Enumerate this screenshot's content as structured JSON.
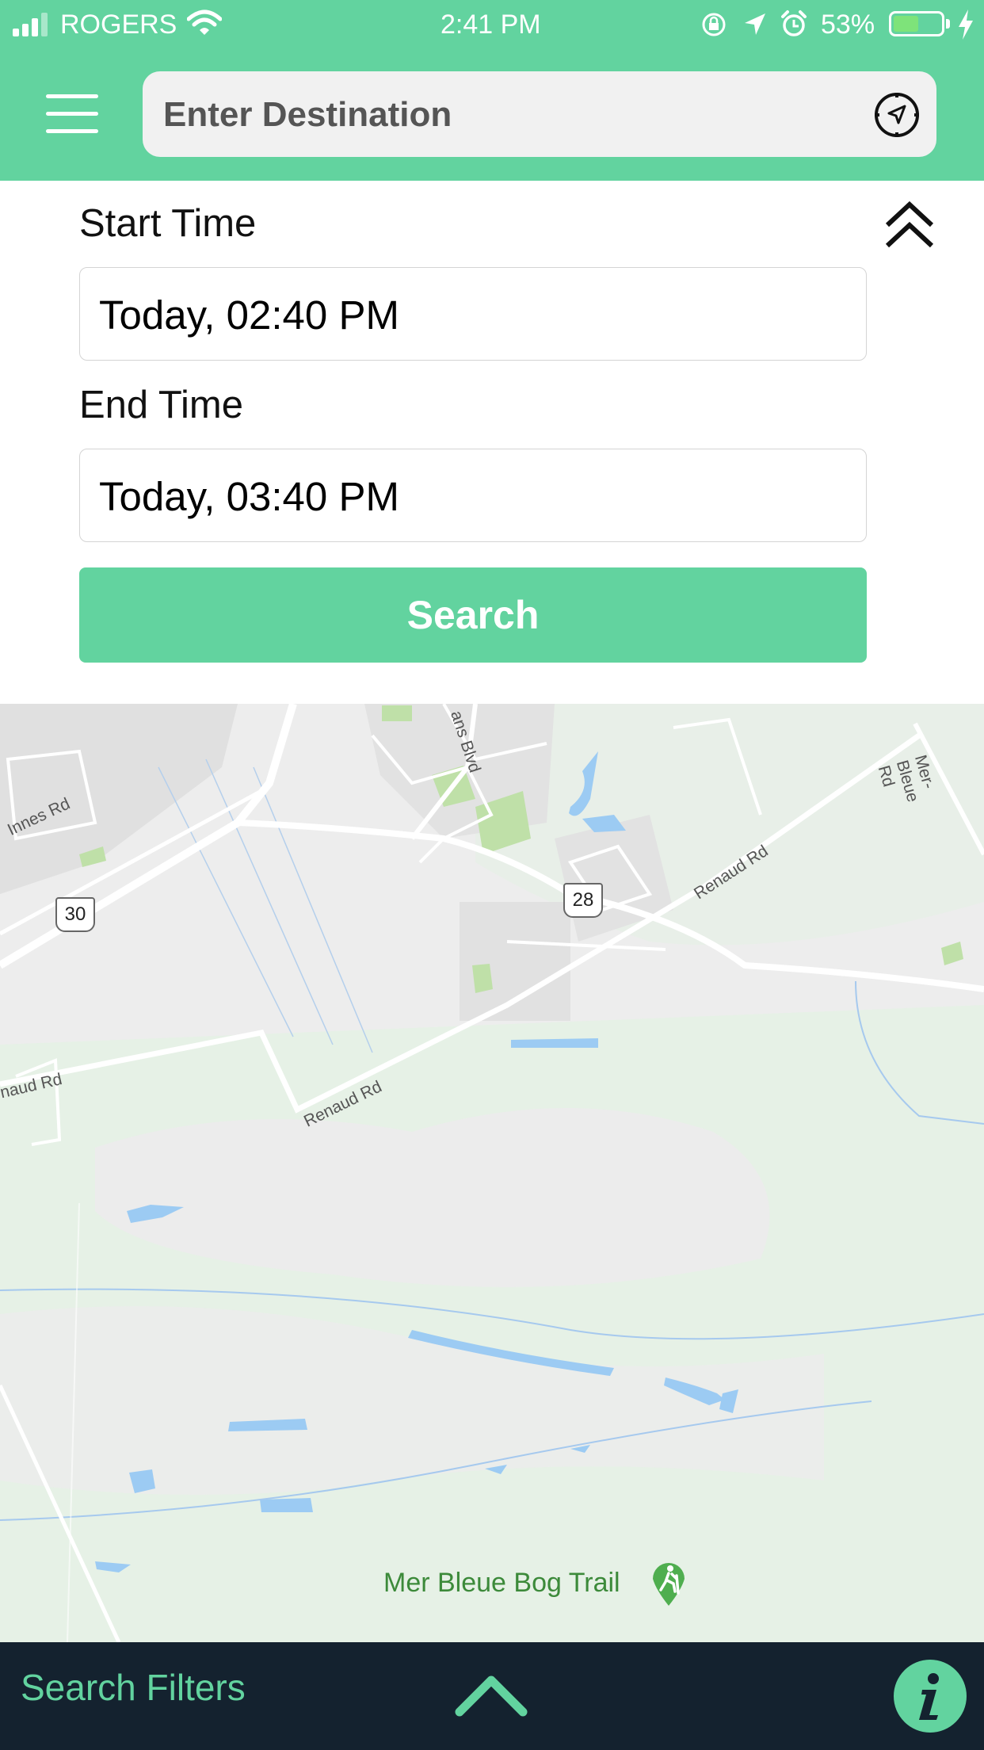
{
  "status_bar": {
    "carrier": "ROGERS",
    "time": "2:41 PM",
    "battery_percent": "53%",
    "battery_level": 0.53,
    "signal_bars": 3
  },
  "header": {
    "destination_placeholder": "Enter Destination",
    "menu_icon": "hamburger-menu-icon",
    "locate_icon": "compass-navigation-icon"
  },
  "form": {
    "start_label": "Start Time",
    "start_value": "Today, 02:40 PM",
    "end_label": "End Time",
    "end_value": "Today, 03:40 PM",
    "search_label": "Search",
    "collapse_icon": "double-chevron-up-icon"
  },
  "map": {
    "road_labels": {
      "innes": "Innes Rd",
      "renaud_left": "naud Rd",
      "renaud_mid": "Renaud Rd",
      "renaud_right": "Renaud Rd",
      "mer_bleue": "Mer-Bleue Rd",
      "blvd": "ans Blvd"
    },
    "route_shields": [
      "30",
      "28"
    ],
    "poi": {
      "name": "Mer Bleue Bog Trail",
      "icon": "hiking-pin-icon"
    }
  },
  "bottom_bar": {
    "filters_label": "Search Filters",
    "expand_icon": "chevron-up-icon",
    "info_icon": "info-icon"
  },
  "colors": {
    "accent": "#62d39f",
    "bottom_bar": "#14222f",
    "map_land": "#ededed",
    "map_park": "#e6f1e6",
    "water": "#9ccbf3"
  }
}
